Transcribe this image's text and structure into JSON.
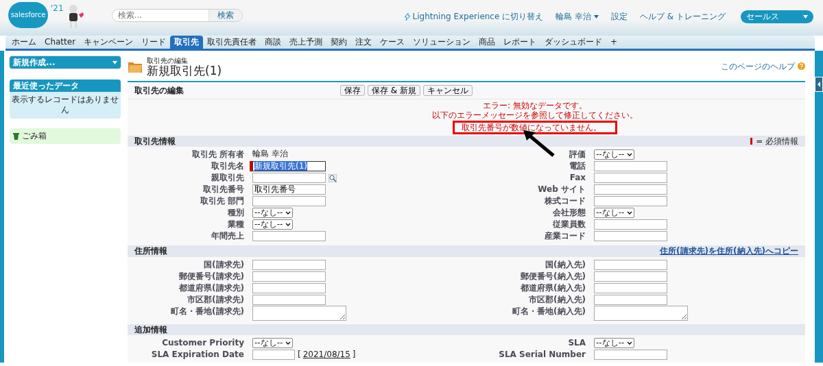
{
  "header": {
    "logo": "salesforce",
    "logo_badge": "'21",
    "search": {
      "placeholder": "検索...",
      "button": "検索"
    },
    "links": [
      {
        "kind": "lightning",
        "label": "Lightning Experience に切り替え"
      },
      {
        "kind": "user",
        "label": "輪島 幸治"
      },
      {
        "kind": "plain",
        "label": "設定"
      },
      {
        "kind": "plain",
        "label": "ヘルプ & トレーニング"
      }
    ],
    "app_menu": "セールス"
  },
  "tabs": [
    {
      "label": "ホーム",
      "selected": false
    },
    {
      "label": "Chatter",
      "selected": false
    },
    {
      "label": "キャンペーン",
      "selected": false
    },
    {
      "label": "リード",
      "selected": false
    },
    {
      "label": "取引先",
      "selected": true
    },
    {
      "label": "取引先責任者",
      "selected": false
    },
    {
      "label": "商談",
      "selected": false
    },
    {
      "label": "売上予測",
      "selected": false
    },
    {
      "label": "契約",
      "selected": false
    },
    {
      "label": "注文",
      "selected": false
    },
    {
      "label": "ケース",
      "selected": false
    },
    {
      "label": "ソリューション",
      "selected": false
    },
    {
      "label": "商品",
      "selected": false
    },
    {
      "label": "レポート",
      "selected": false
    },
    {
      "label": "ダッシュボード",
      "selected": false
    },
    {
      "label": "+",
      "selected": false
    }
  ],
  "sidebar": {
    "create_menu": "新規作成...",
    "recent": {
      "title": "最近使ったデータ",
      "empty": "表示するレコードはありません"
    },
    "recycle_bin": "ごみ箱"
  },
  "page": {
    "subtitle": "取引先の編集",
    "title": "新規取引先(1)",
    "help": "このページのヘルプ"
  },
  "form": {
    "title": "取引先の編集",
    "buttons": [
      "保存",
      "保存 & 新規",
      "キャンセル"
    ],
    "errors": [
      {
        "text": "エラー: 無効なデータです。",
        "highlighted": false
      },
      {
        "text": "以下のエラーメッセージを参照して修正してください。",
        "highlighted": false
      },
      {
        "text": "取引先番号が数値になっていません。",
        "highlighted": true
      }
    ],
    "sections": [
      {
        "title": "取引先情報",
        "note": "= 必須情報",
        "rows": [
          [
            {
              "label": "取引先 所有者",
              "kind": "static",
              "value": "輪島 幸治"
            },
            {
              "label": "評価",
              "kind": "select",
              "value": "--なし--"
            }
          ],
          [
            {
              "label": "取引先名",
              "kind": "text",
              "value": "新規取引先(1)",
              "required": true,
              "text_selected": true
            },
            {
              "label": "電話",
              "kind": "text"
            }
          ],
          [
            {
              "label": "親取引先",
              "kind": "lookup"
            },
            {
              "label": "Fax",
              "kind": "text"
            }
          ],
          [
            {
              "label": "取引先番号",
              "kind": "text",
              "value": "取引先番号"
            },
            {
              "label": "Web サイト",
              "kind": "text"
            }
          ],
          [
            {
              "label": "取引先 部門",
              "kind": "text"
            },
            {
              "label": "株式コード",
              "kind": "text"
            }
          ],
          [
            {
              "label": "種別",
              "kind": "select",
              "value": "--なし--"
            },
            {
              "label": "会社形態",
              "kind": "select",
              "value": "--なし--"
            }
          ],
          [
            {
              "label": "業種",
              "kind": "select",
              "value": "--なし--"
            },
            {
              "label": "従業員数",
              "kind": "text"
            }
          ],
          [
            {
              "label": "年間売上",
              "kind": "text"
            },
            {
              "label": "産業コード",
              "kind": "text"
            }
          ]
        ]
      },
      {
        "title": "住所情報",
        "link": "住所(請求先)を住所(納入先)へコピー",
        "rows": [
          [
            {
              "label": "国(請求先)",
              "kind": "text"
            },
            {
              "label": "国(納入先)",
              "kind": "text"
            }
          ],
          [
            {
              "label": "郵便番号(請求先)",
              "kind": "text"
            },
            {
              "label": "郵便番号(納入先)",
              "kind": "text"
            }
          ],
          [
            {
              "label": "都道府県(請求先)",
              "kind": "text"
            },
            {
              "label": "都道府県(納入先)",
              "kind": "text"
            }
          ],
          [
            {
              "label": "市区郡(請求先)",
              "kind": "text"
            },
            {
              "label": "市区郡(納入先)",
              "kind": "text"
            }
          ],
          [
            {
              "label": "町名・番地(請求先)",
              "kind": "textarea"
            },
            {
              "label": "町名・番地(納入先)",
              "kind": "textarea"
            }
          ]
        ]
      },
      {
        "title": "追加情報",
        "rows": [
          [
            {
              "label": "Customer Priority",
              "kind": "select",
              "value": "--なし--"
            },
            {
              "label": "SLA",
              "kind": "select",
              "value": "--なし--"
            }
          ],
          [
            {
              "label": "SLA Expiration Date",
              "kind": "date",
              "date": "2021/08/15",
              "open_bracket": "[",
              "close_bracket": "]"
            },
            {
              "label": "SLA Serial Number",
              "kind": "text"
            }
          ]
        ]
      }
    ]
  }
}
